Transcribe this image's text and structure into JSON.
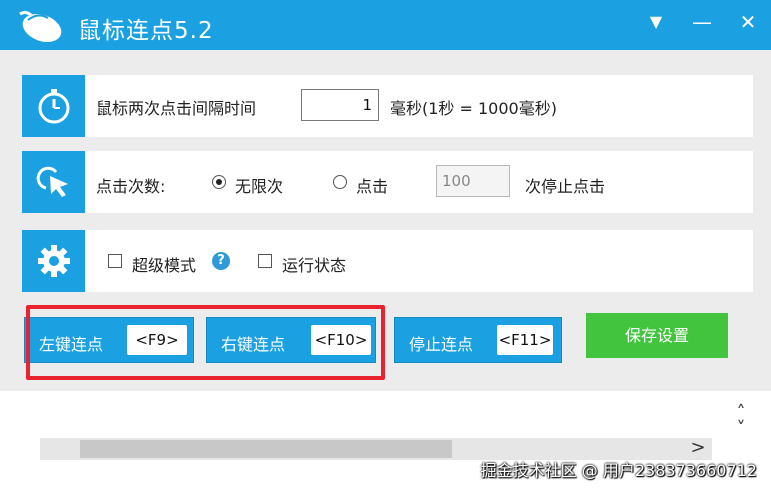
{
  "titlebar": {
    "title": "鼠标连点5.2",
    "pin_glyph": "▼",
    "minimize_glyph": "—",
    "close_glyph": "✕"
  },
  "interval_panel": {
    "label": "鼠标两次点击间隔时间",
    "value": "1",
    "unit": "毫秒(1秒 = 1000毫秒)",
    "icon": "stopwatch-icon"
  },
  "count_panel": {
    "label": "点击次数:",
    "option_unlimited": "无限次",
    "option_click": "点击",
    "count_value": "100",
    "suffix": "次停止点击",
    "selected": "无限次",
    "icon": "cursor-click-icon"
  },
  "options_panel": {
    "super_mode": "超级模式",
    "run_status": "运行状态",
    "help_glyph": "?",
    "icon": "gear-icon"
  },
  "buttons": {
    "left_click": {
      "label": "左键连点",
      "key": "<F9>"
    },
    "right_click": {
      "label": "右键连点",
      "key": "<F10>"
    },
    "stop_click": {
      "label": "停止连点",
      "key": "<F11>"
    },
    "save": "保存设置"
  },
  "scroll": {
    "left": "<",
    "right": ">",
    "up": "˄",
    "down": "˅"
  },
  "watermark": "掘金技术社区 @ 用户2383736607​12",
  "colors": {
    "accent": "#1ba1e2",
    "save": "#43c43f",
    "highlight": "#e8232f"
  }
}
